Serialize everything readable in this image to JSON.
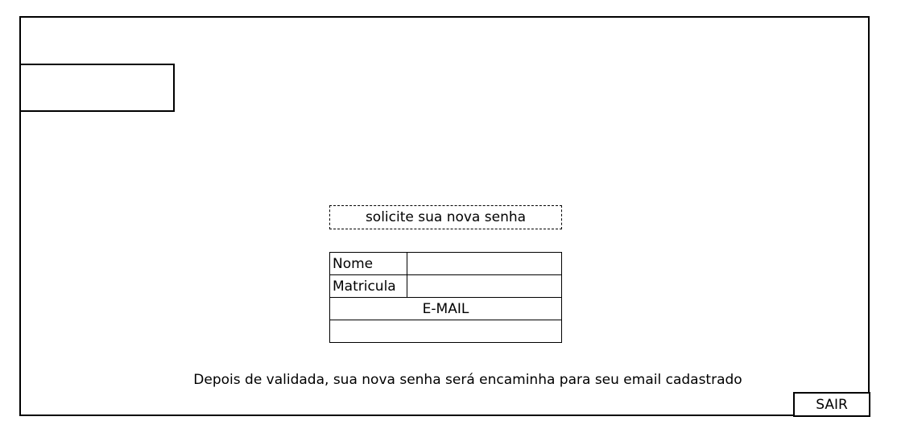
{
  "form": {
    "heading": "solicite sua nova senha",
    "fields": [
      {
        "label": "Nome",
        "value": ""
      },
      {
        "label": "Matricula",
        "value": ""
      }
    ],
    "email_label": "E-MAIL",
    "email_value": ""
  },
  "footer": {
    "info_text": "Depois de validada, sua nova senha será encaminha para seu email cadastrado",
    "exit_label": "SAIR"
  }
}
